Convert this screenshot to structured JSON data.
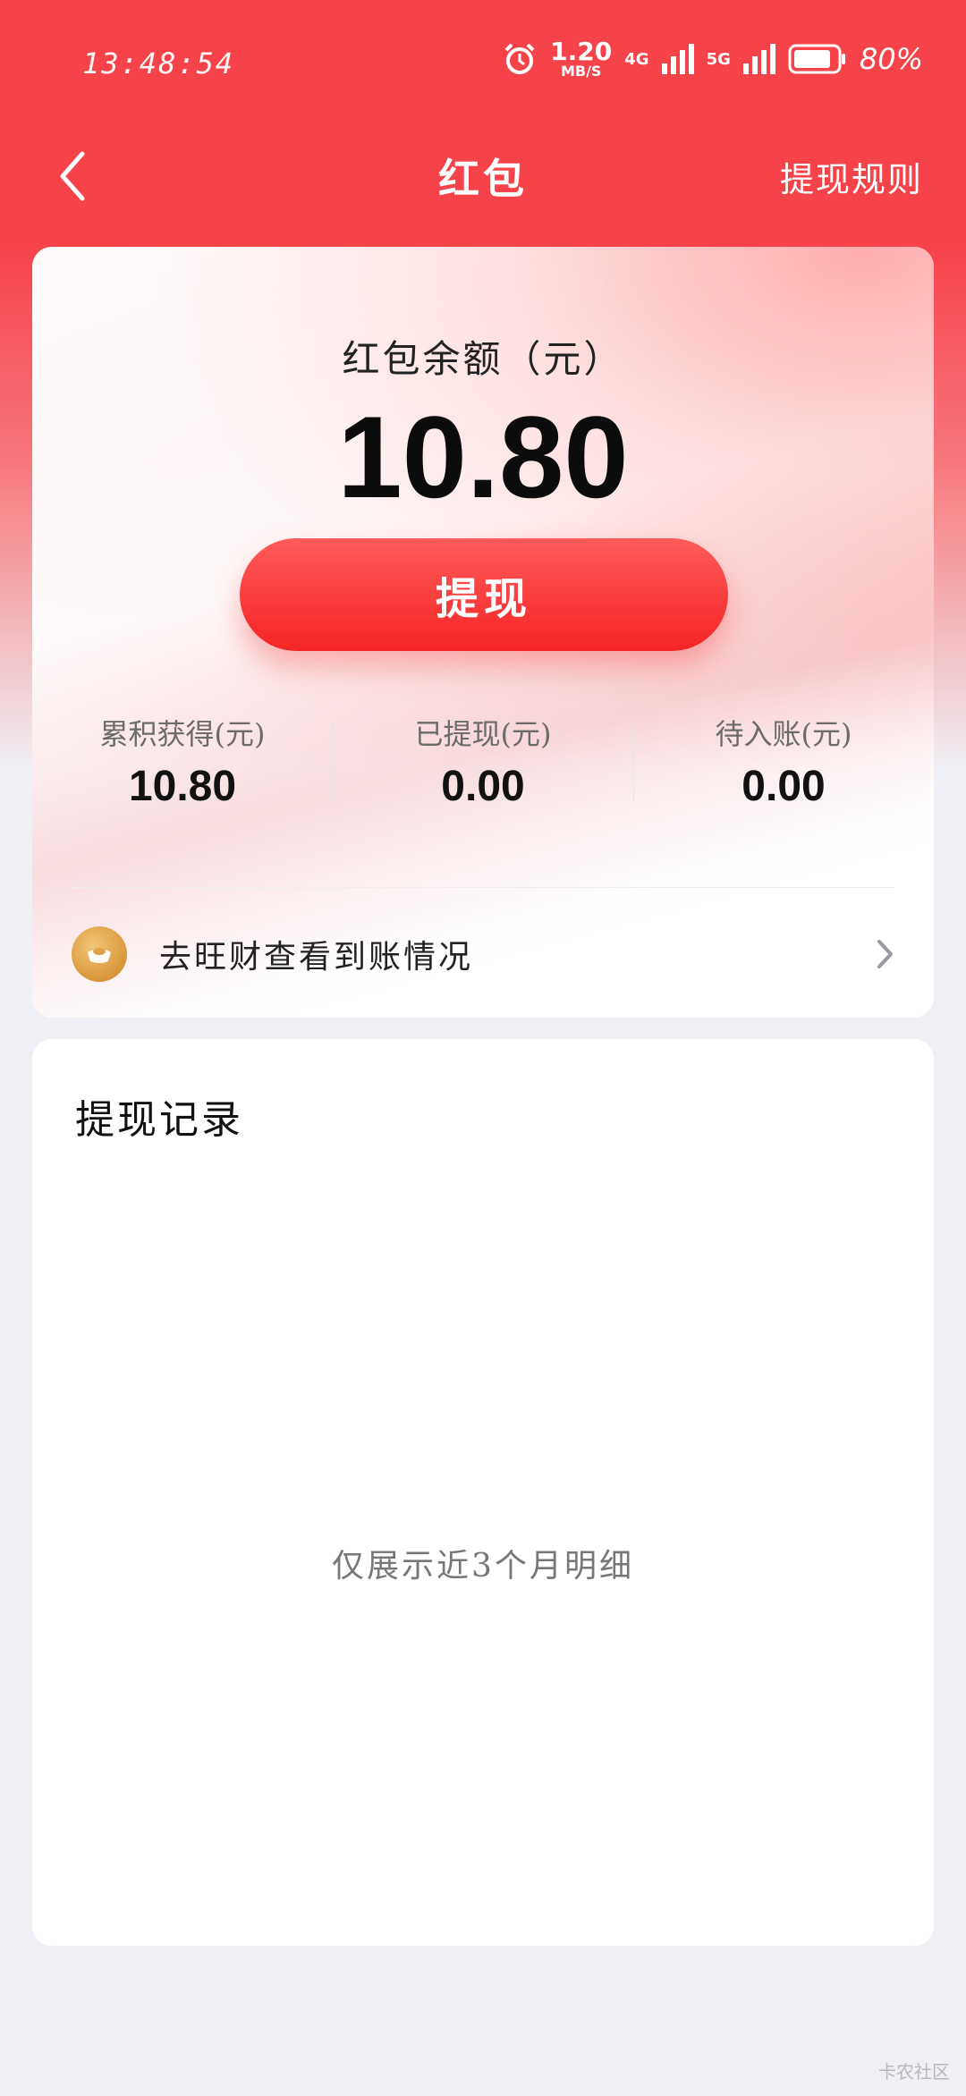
{
  "status_bar": {
    "time": "13:48:54",
    "speed_value": "1.20",
    "speed_unit": "MB/S",
    "net1": "4G",
    "net2": "5G",
    "battery": "80%"
  },
  "nav": {
    "title": "红包",
    "rules_label": "提现规则"
  },
  "balance": {
    "label": "红包余额（元）",
    "amount": "10.80",
    "withdraw_label": "提现"
  },
  "stats": [
    {
      "label": "累积获得(元)",
      "value": "10.80"
    },
    {
      "label": "已提现(元)",
      "value": "0.00"
    },
    {
      "label": "待入账(元)",
      "value": "0.00"
    }
  ],
  "check_row": {
    "label": "去旺财查看到账情况"
  },
  "records": {
    "title": "提现记录",
    "empty_text": "仅展示近3个月明细"
  },
  "watermark": "卡农社区",
  "colors": {
    "header_red": "#f6434a",
    "button_red": "#f52424",
    "coin_gold": "#d9963a",
    "page_bg": "#eff0f5"
  }
}
